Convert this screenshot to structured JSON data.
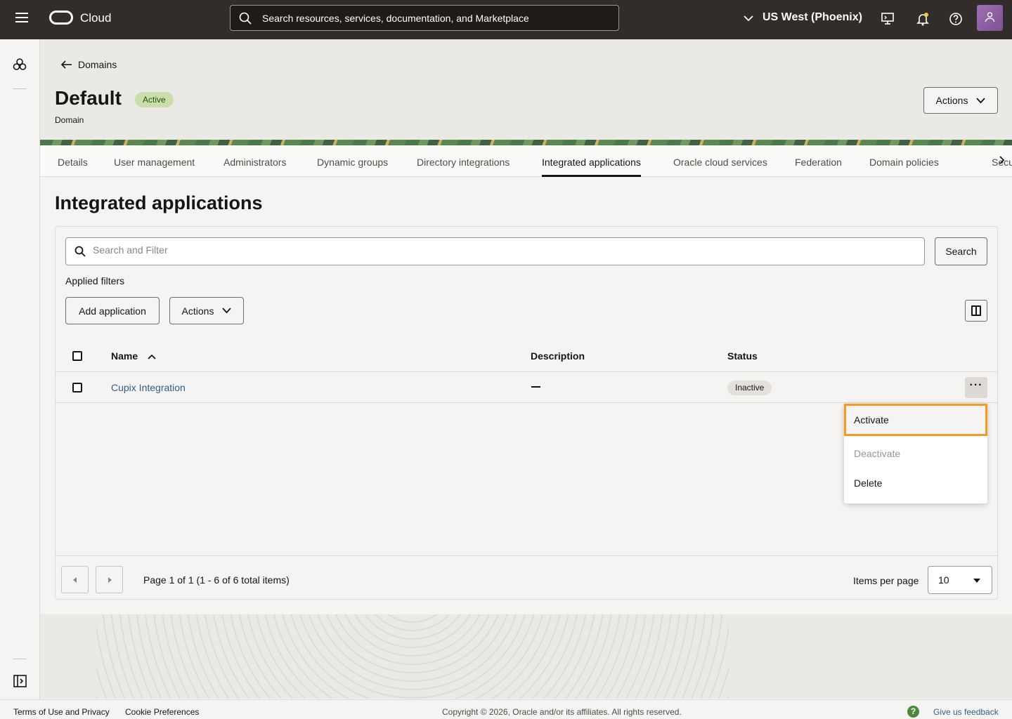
{
  "header": {
    "brand": "Cloud",
    "search_text": "Search resources, services, documentation, and Marketplace",
    "region": "US West (Phoenix)"
  },
  "page": {
    "back_label": "Domains",
    "title": "Default",
    "status": "Active",
    "subtitle": "Domain",
    "actions_label": "Actions"
  },
  "tabs": [
    {
      "label": "Details"
    },
    {
      "label": "User management"
    },
    {
      "label": "Administrators"
    },
    {
      "label": "Dynamic groups"
    },
    {
      "label": "Directory integrations"
    },
    {
      "label": "Integrated applications"
    },
    {
      "label": "Oracle cloud services"
    },
    {
      "label": "Federation"
    },
    {
      "label": "Domain policies"
    },
    {
      "label": "Security"
    }
  ],
  "main": {
    "title": "Integrated applications",
    "filter_placeholder": "Search and Filter",
    "search_button": "Search",
    "applied_filters": "Applied filters",
    "add_application": "Add application",
    "actions_label": "Actions"
  },
  "table": {
    "columns": [
      "Name",
      "Description",
      "Status"
    ],
    "rows": [
      {
        "name": "Cupix Integration",
        "status": "Inactive"
      }
    ]
  },
  "row_menu": {
    "items": [
      "Activate",
      "Deactivate",
      "Delete"
    ]
  },
  "pagination": {
    "info": "Page 1 of 1 (1 - 6 of 6 total items)",
    "items_per_page_label": "Items per page",
    "items_per_page": "10"
  },
  "footer": {
    "terms": "Terms of Use and Privacy",
    "cookies": "Cookie Preferences",
    "copyright": "Copyright © 2026, Oracle and/or its affiliates. All rights reserved.",
    "feedback": "Give us feedback"
  },
  "colors": {
    "header_bg": "#312d2a",
    "active_badge": "#c8dfa9",
    "link": "#2f5f8a",
    "highlight": "#f59b1f"
  }
}
